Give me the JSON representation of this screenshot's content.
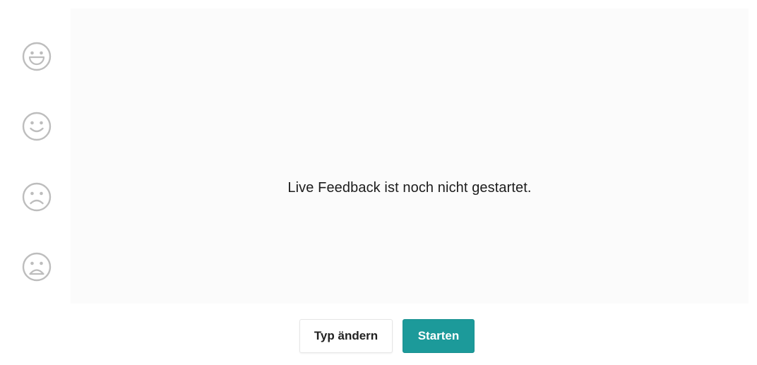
{
  "feedback": {
    "status_message": "Live Feedback ist noch nicht gestartet.",
    "options": [
      {
        "icon": "very-happy-face-icon"
      },
      {
        "icon": "happy-face-icon"
      },
      {
        "icon": "sad-face-icon"
      },
      {
        "icon": "very-sad-face-icon"
      }
    ]
  },
  "actions": {
    "change_type_label": "Typ ändern",
    "start_label": "Starten"
  },
  "colors": {
    "accent": "#1c9a9a",
    "icon": "#bdbdbd"
  }
}
